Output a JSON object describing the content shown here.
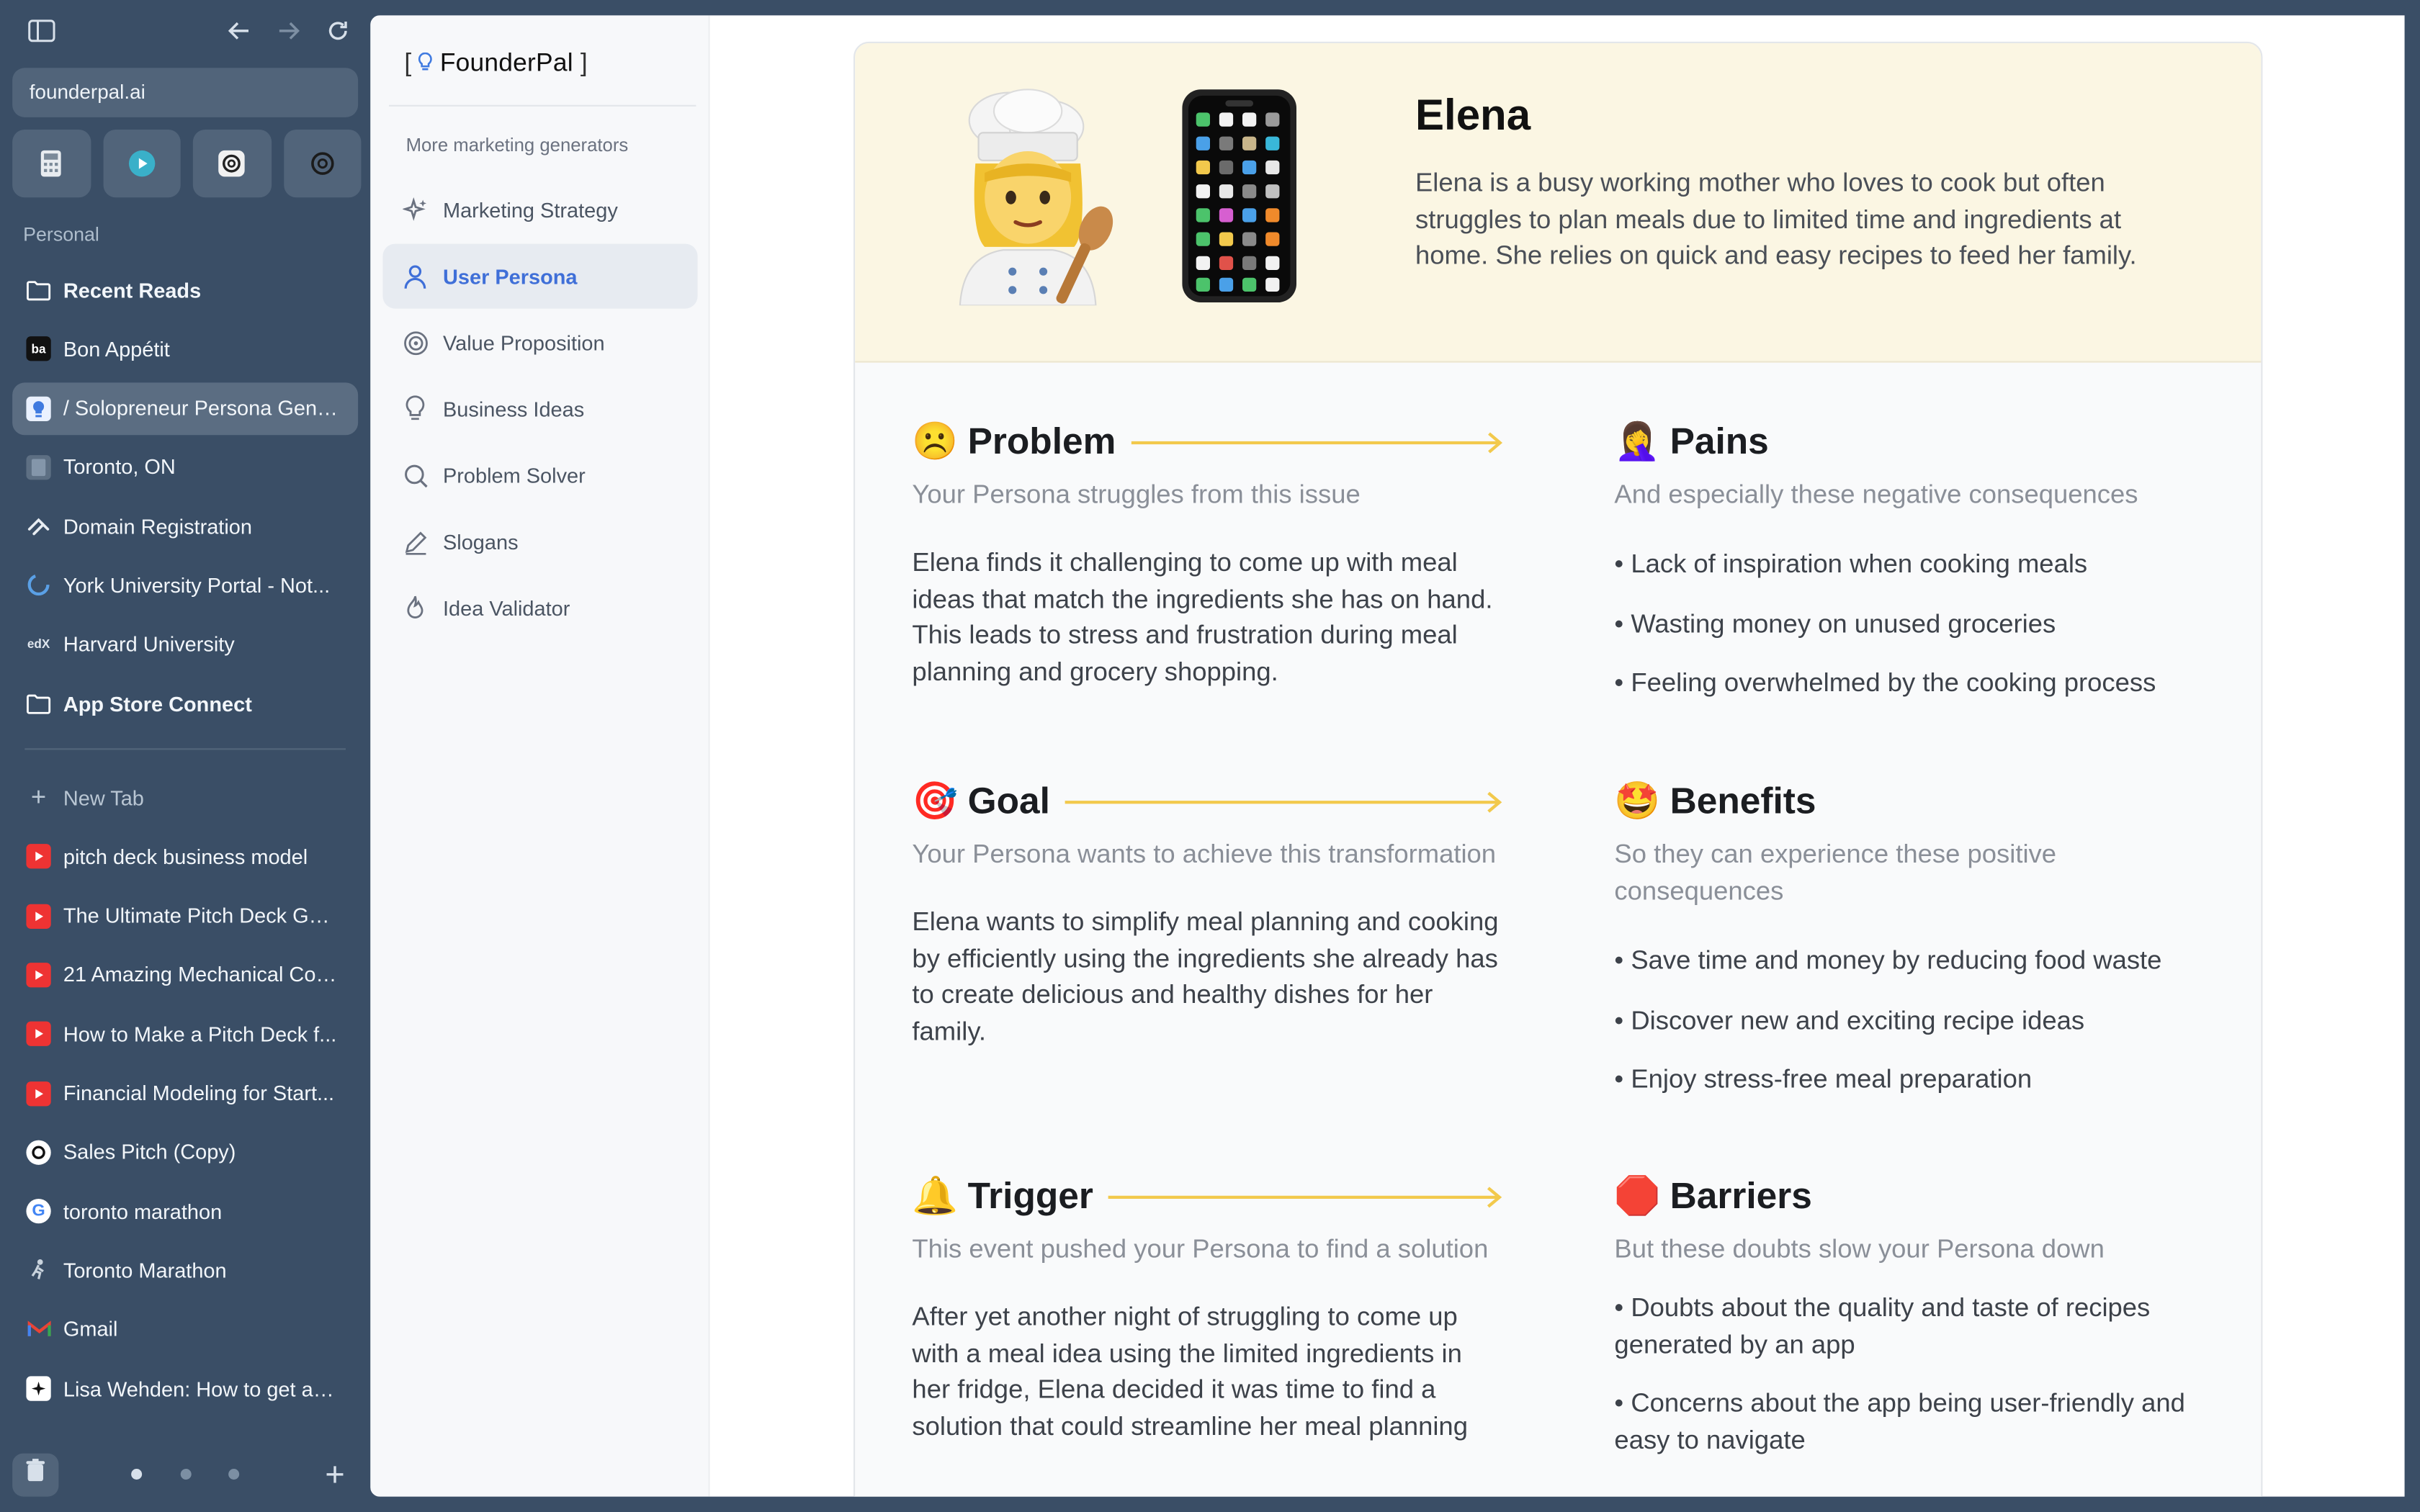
{
  "browser": {
    "url": "founderpal.ai",
    "section_label": "Personal",
    "tabs": [
      {
        "label": "Recent Reads",
        "kind": "folder",
        "bold": true
      },
      {
        "label": "Bon Appétit",
        "kind": "ba"
      },
      {
        "label": "/ Solopreneur Persona Gener...",
        "kind": "fp",
        "selected": true
      },
      {
        "label": "Toronto, ON",
        "kind": "doc"
      },
      {
        "label": "Domain Registration",
        "kind": "sq"
      },
      {
        "label": "York University Portal - Not...",
        "kind": "ring"
      },
      {
        "label": "Harvard University",
        "kind": "edx"
      },
      {
        "label": "App Store Connect",
        "kind": "folder",
        "bold": true
      }
    ],
    "new_tab_label": "New Tab",
    "tabs2": [
      {
        "label": "pitch deck business model",
        "kind": "yt"
      },
      {
        "label": "The Ultimate Pitch Deck Gui...",
        "kind": "yt"
      },
      {
        "label": "21 Amazing Mechanical Con...",
        "kind": "yt"
      },
      {
        "label": "How to Make a Pitch Deck f...",
        "kind": "yt"
      },
      {
        "label": "Financial Modeling for Start...",
        "kind": "yt"
      },
      {
        "label": "Sales Pitch (Copy)",
        "kind": "sp"
      },
      {
        "label": "toronto marathon",
        "kind": "g"
      },
      {
        "label": "Toronto Marathon",
        "kind": "run"
      },
      {
        "label": "Gmail",
        "kind": "gm"
      },
      {
        "label": "Lisa Wehden: How to get an...",
        "kind": "star"
      }
    ]
  },
  "app": {
    "logo_open": "[",
    "logo_name": "FounderPal",
    "logo_close": "]",
    "nav_subtitle": "More marketing generators",
    "nav": [
      {
        "label": "Marketing Strategy",
        "icon": "sparkle-icon"
      },
      {
        "label": "User Persona",
        "icon": "user-icon",
        "active": true
      },
      {
        "label": "Value Proposition",
        "icon": "target-icon"
      },
      {
        "label": "Business Ideas",
        "icon": "bulb-icon"
      },
      {
        "label": "Problem Solver",
        "icon": "search-icon"
      },
      {
        "label": "Slogans",
        "icon": "pencil-icon"
      },
      {
        "label": "Idea Validator",
        "icon": "flame-icon"
      }
    ]
  },
  "persona": {
    "name": "Elena",
    "description": "Elena is a busy working mother who loves to cook but often struggles to plan meals due to limited time and ingredients at home. She relies on quick and easy recipes to feed her family.",
    "problem": {
      "emoji": "☹️",
      "title": "Problem",
      "subtitle": "Your Persona struggles from this issue",
      "body": "Elena finds it challenging to come up with meal ideas that match the ingredients she has on hand. This leads to stress and frustration during meal planning and grocery shopping."
    },
    "pains": {
      "emoji": "🤦‍♀️",
      "title": "Pains",
      "subtitle": "And especially these negative consequences",
      "items": [
        "Lack of inspiration when cooking meals",
        "Wasting money on unused groceries",
        "Feeling overwhelmed by the cooking process"
      ]
    },
    "goal": {
      "emoji": "🎯",
      "title": "Goal",
      "subtitle": "Your Persona wants to achieve this transformation",
      "body": "Elena wants to simplify meal planning and cooking by efficiently using the ingredients she already has to create delicious and healthy dishes for her family."
    },
    "benefits": {
      "emoji": "🤩",
      "title": "Benefits",
      "subtitle": "So they can experience these positive consequences",
      "items": [
        "Save time and money by reducing food waste",
        "Discover new and exciting recipe ideas",
        "Enjoy stress-free meal preparation"
      ]
    },
    "trigger": {
      "emoji": "🔔",
      "title": "Trigger",
      "subtitle": "This event pushed your Persona to find a solution",
      "body": "After yet another night of struggling to come up with a meal idea using the limited ingredients in her fridge, Elena decided it was time to find a solution that could streamline her meal planning"
    },
    "barriers": {
      "emoji": "🛑",
      "title": "Barriers",
      "subtitle": "But these doubts slow your Persona down",
      "items": [
        "Doubts about the quality and taste of recipes generated by an app",
        "Concerns about the app being user-friendly and easy to navigate"
      ]
    }
  },
  "colors": {
    "accent": "#3f6fd8",
    "arrow": "#f2c94c",
    "hero_bg": "#fbf6e3"
  }
}
